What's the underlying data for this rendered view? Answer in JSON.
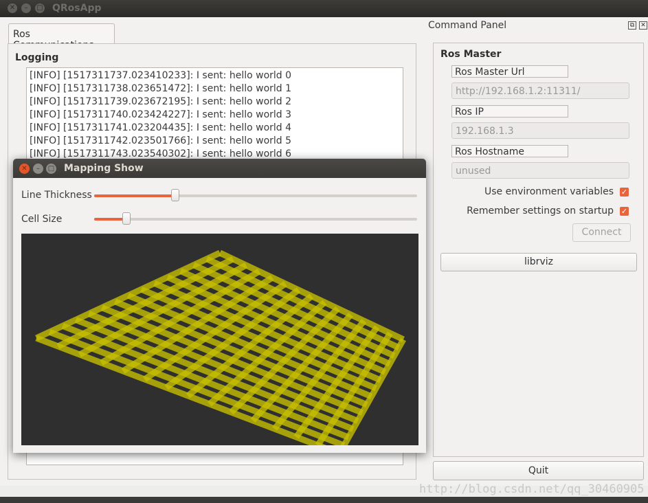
{
  "window": {
    "title": "QRosApp"
  },
  "tabs": [
    {
      "label": "Ros Communications"
    }
  ],
  "logging": {
    "label": "Logging",
    "lines": [
      "[INFO] [1517311737.023410233]: I sent: hello world 0",
      "[INFO] [1517311738.023651472]: I sent: hello world 1",
      "[INFO] [1517311739.023672195]: I sent: hello world 2",
      "[INFO] [1517311740.023424227]: I sent: hello world 3",
      "[INFO] [1517311741.023204435]: I sent: hello world 4",
      "[INFO] [1517311742.023501766]: I sent: hello world 5",
      "[INFO] [1517311743.023540302]: I sent: hello world 6"
    ]
  },
  "command_panel": {
    "title": "Command Panel",
    "section": "Ros Master",
    "master_url_label": "Ros Master Url",
    "master_url_value": "http://192.168.1.2:11311/",
    "ip_label": "Ros IP",
    "ip_value": "192.168.1.3",
    "hostname_label": "Ros Hostname",
    "hostname_value": "unused",
    "use_env_label": "Use environment variables",
    "use_env_checked": true,
    "remember_label": "Remember settings on startup",
    "remember_checked": true,
    "connect_label": "Connect",
    "librviz_label": "librviz",
    "quit_label": "Quit"
  },
  "mapping_window": {
    "title": "Mapping Show",
    "line_thickness_label": "Line Thickness",
    "line_thickness_value": 0.25,
    "cell_size_label": "Cell Size",
    "cell_size_value": 0.1,
    "grid_color": "#c8c000",
    "background_color": "#2f2f2f"
  },
  "watermark": "http://blog.csdn.net/qq_30460905",
  "colors": {
    "accent": "#e9643a",
    "close": "#e2562c"
  }
}
